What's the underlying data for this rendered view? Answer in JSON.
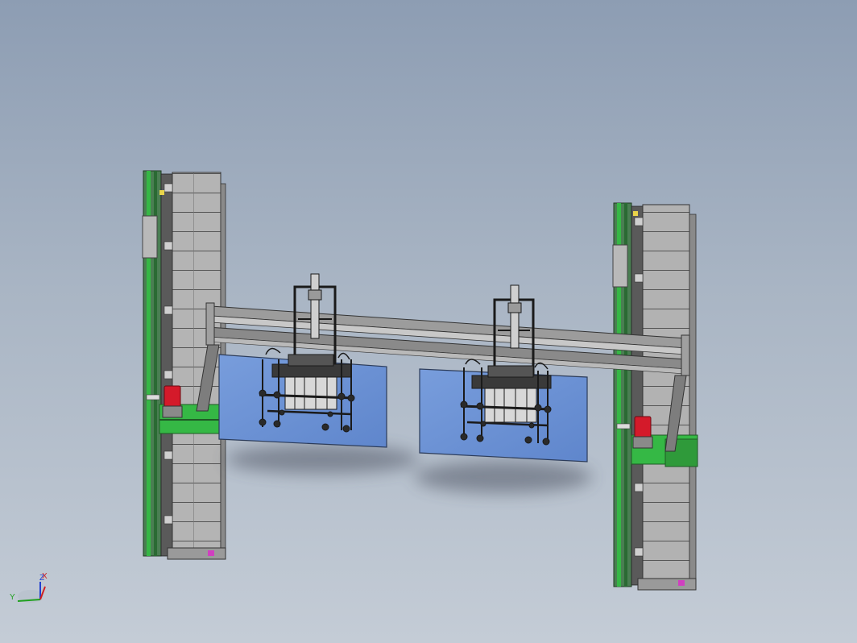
{
  "viewport": {
    "background": {
      "top": "#8d9db3",
      "bottom": "#c4ccd6"
    }
  },
  "model": {
    "colors": {
      "frame_gray": "#a9a9a9",
      "frame_dark": "#3c3c3c",
      "rail_green": "#2f8f3f",
      "plate_green": "#35b845",
      "panel_blue": "#6f95d6",
      "motor_red": "#d41a2a",
      "cylinder": "#cfcfcf",
      "accent_magenta": "#d040c0",
      "accent_yellow": "#e8d44a"
    },
    "parts": [
      "left-column",
      "right-column",
      "gantry-beam",
      "left-gripper-head",
      "right-gripper-head",
      "left-glass-panel",
      "right-glass-panel",
      "left-motor",
      "right-motor"
    ]
  },
  "triad": {
    "x_label": "X",
    "y_label": "Y",
    "z_label": "Z",
    "colors": {
      "x": "#d02020",
      "y": "#20a020",
      "z": "#2040d0"
    }
  }
}
